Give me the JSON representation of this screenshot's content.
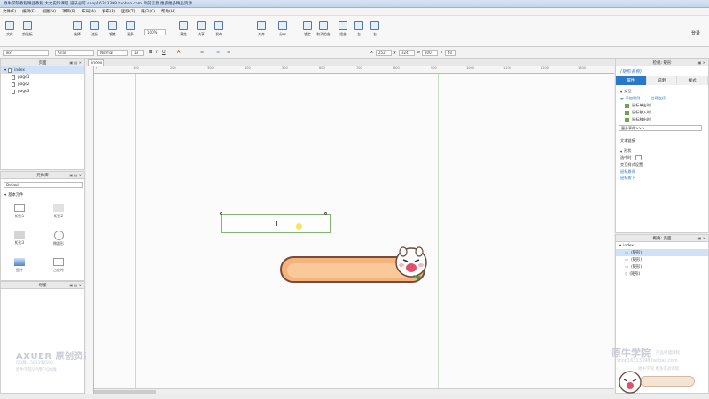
{
  "titlebar": {
    "text": "原牛学院教程精品教程    大文史料课程 道法必可    shop16313398.taobao.com    目前信息 更多更多精品资源"
  },
  "menubar": {
    "items": [
      "文件(F)",
      "编辑(E)",
      "视图(V)",
      "项目(P)",
      "布局(A)",
      "发布(P)",
      "团队(T)",
      "账户(C)",
      "帮助(H)"
    ]
  },
  "toolbar": {
    "buttons": [
      "文件",
      "剪贴板",
      "选择",
      "连接",
      "钢笔",
      "更多",
      "缩放",
      "预览",
      "共享",
      "发布",
      "对齐",
      "分布",
      "锁定",
      "取消组合",
      "组合",
      "左",
      "右"
    ],
    "zoom": "100%",
    "login": "登录"
  },
  "formatbar": {
    "style": "Text",
    "font": "Arial",
    "weight": "Normal",
    "size": "13",
    "x": "252",
    "y": "324",
    "w": "300",
    "h": "40",
    "x_label": "x",
    "y_label": "y",
    "w_label": "w",
    "h_label": "h"
  },
  "pages": {
    "title": "页面",
    "root": "index",
    "children": [
      "page1",
      "page2",
      "page3"
    ]
  },
  "widgets": {
    "title": "元件库",
    "library": "Default",
    "search": "",
    "category": "基本元件",
    "items": [
      "矩形1",
      "矩形2",
      "矩形3",
      "椭圆形",
      "图片",
      "占位符"
    ]
  },
  "masters": {
    "title": "母版"
  },
  "canvas": {
    "tab": "index",
    "ruler_ticks": [
      "0",
      "100",
      "200",
      "300",
      "400",
      "500",
      "600",
      "700",
      "800",
      "900",
      "1000",
      "1100",
      "1200",
      "1300"
    ]
  },
  "inspector": {
    "header": "检视: 矩形",
    "name_placeholder": "(矩形名称)",
    "tabs": [
      "属性",
      "说明",
      "样式"
    ],
    "section": "交互",
    "add_case": "添加用例",
    "create_link": "创建连接",
    "events": [
      "鼠标单击时",
      "鼠标移入时",
      "鼠标移出时"
    ],
    "more_events": "更多事件>>>",
    "text_link": "文本链接",
    "shape_label": "形状",
    "select_label": "选中时",
    "interaction_style": "交互样式设置",
    "mouse_over": "鼠标悬停",
    "mouse_down": "鼠标按下"
  },
  "outline": {
    "title": "概要: 页面",
    "root": "index",
    "items": [
      "(矩形)",
      "(矩形)",
      "(矩形)",
      "(矩形)"
    ]
  },
  "watermarks": {
    "left_title": "AXUER 原创资源",
    "left_qq": "QQ群：583192595",
    "left_sub": "原牛学院VIP用户QQ群",
    "right_title": "原牛学院",
    "right_tag": "产品经理课程",
    "right_shop": "shop16313398.taobao.com",
    "right_sub": "原牛学院 更多实战课程"
  },
  "colors": {
    "accent": "#2a79c8",
    "selection_border": "#7cb96f",
    "banner": "#f4b37a"
  }
}
